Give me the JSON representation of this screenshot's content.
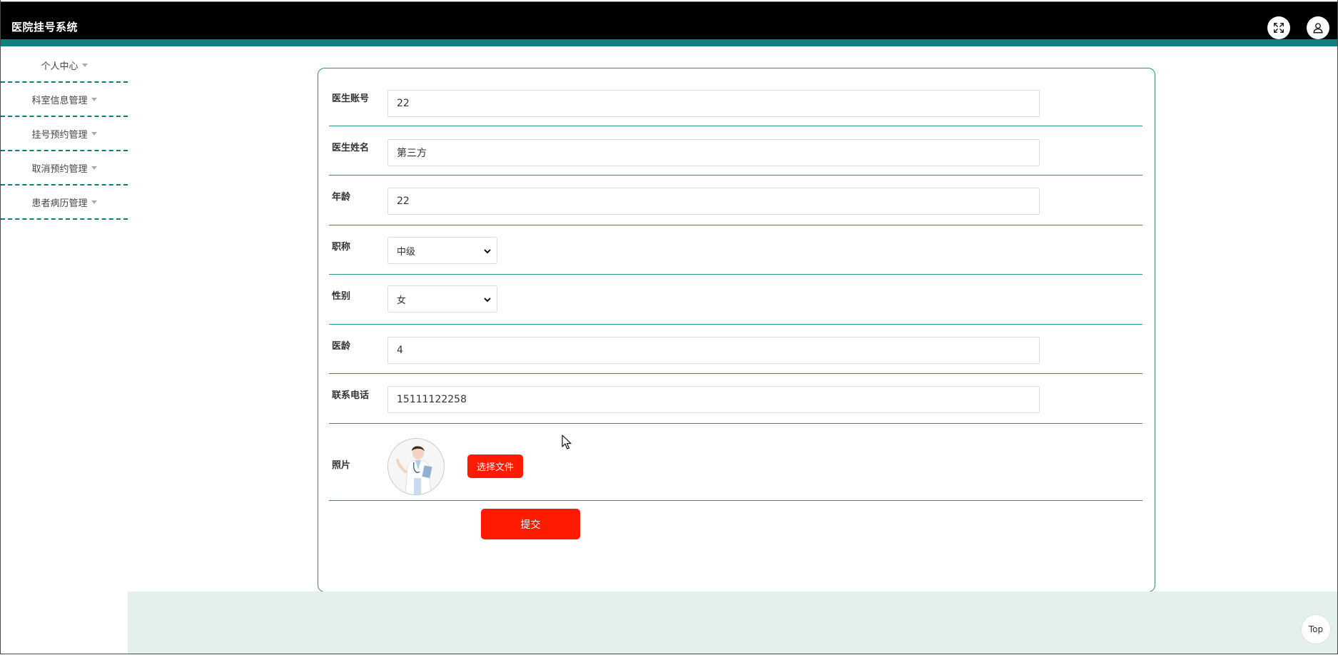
{
  "app": {
    "title": "医院挂号系统"
  },
  "header": {
    "fullscreen_icon": "expand-icon",
    "user_icon": "user-icon"
  },
  "sidebar": {
    "items": [
      {
        "label": "个人中心"
      },
      {
        "label": "科室信息管理"
      },
      {
        "label": "挂号预约管理"
      },
      {
        "label": "取消预约管理"
      },
      {
        "label": "患者病历管理"
      }
    ]
  },
  "form": {
    "doctor_account": {
      "label": "医生账号",
      "value": "22"
    },
    "doctor_name": {
      "label": "医生姓名",
      "value": "第三方"
    },
    "age": {
      "label": "年龄",
      "value": "22"
    },
    "title": {
      "label": "职称",
      "value": "中级"
    },
    "gender": {
      "label": "性别",
      "value": "女"
    },
    "years": {
      "label": "医龄",
      "value": "4"
    },
    "phone": {
      "label": "联系电话",
      "value": "15111122258"
    },
    "photo": {
      "label": "照片",
      "choose_label": "选择文件"
    },
    "submit_label": "提交"
  },
  "top_button": {
    "label": "Top"
  },
  "colors": {
    "teal": "#0f8080",
    "red": "#ff1a00",
    "footer": "#e4f0ee"
  }
}
